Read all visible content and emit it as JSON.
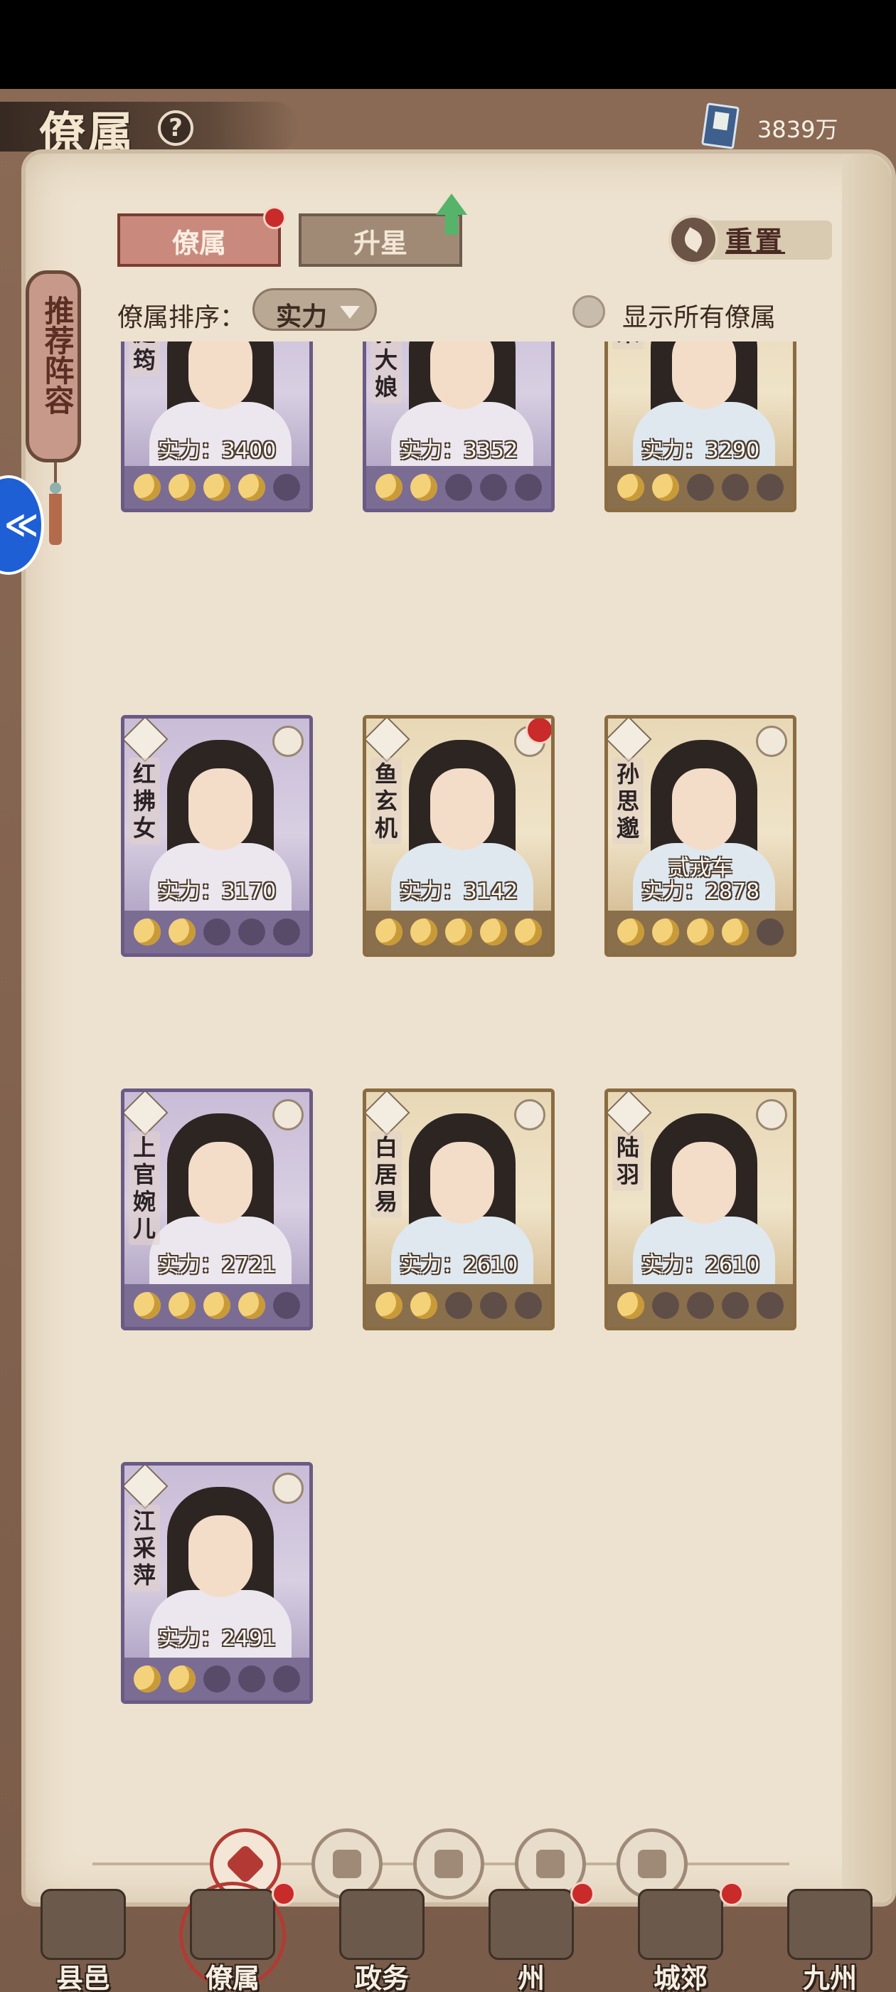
{
  "header": {
    "title": "僚属",
    "help": "?",
    "currency_value": "3839万"
  },
  "side_tag": {
    "label": "推荐阵容"
  },
  "tabs": [
    {
      "label": "僚属",
      "active": true,
      "badge": true
    },
    {
      "label": "升星",
      "active": false,
      "arrow": true
    }
  ],
  "reset_label": "重置",
  "sort": {
    "label": "僚属排序：",
    "value": "实力"
  },
  "show_all_label": "显示所有僚属",
  "cards": [
    {
      "name": "庭筠",
      "power": "实力：3400",
      "theme": "purple",
      "stars": 4,
      "star_total": 5,
      "red_dot": false,
      "subtag": ""
    },
    {
      "name": "公孙大娘",
      "display_name": "孙大娘",
      "power": "实力：3352",
      "theme": "purple",
      "stars": 2,
      "star_total": 5,
      "red_dot": false,
      "subtag": ""
    },
    {
      "name": "张果",
      "display_name": "果",
      "power": "实力：3290",
      "theme": "gold",
      "stars": 2,
      "star_total": 5,
      "red_dot": false,
      "subtag": ""
    },
    {
      "name": "红拂女",
      "power": "实力：3170",
      "theme": "purple",
      "stars": 2,
      "star_total": 5,
      "red_dot": false,
      "subtag": ""
    },
    {
      "name": "鱼玄机",
      "power": "实力：3142",
      "theme": "gold",
      "stars": 5,
      "star_total": 5,
      "red_dot": true,
      "subtag": ""
    },
    {
      "name": "孙思邈",
      "power": "实力：2878",
      "theme": "gold",
      "stars": 4,
      "star_total": 5,
      "red_dot": false,
      "subtag": "贰戎车"
    },
    {
      "name": "上官婉儿",
      "power": "实力：2721",
      "theme": "purple",
      "stars": 4,
      "star_total": 5,
      "red_dot": false,
      "subtag": ""
    },
    {
      "name": "白居易",
      "power": "实力：2610",
      "theme": "gold",
      "stars": 2,
      "star_total": 5,
      "red_dot": false,
      "subtag": ""
    },
    {
      "name": "陆羽",
      "power": "实力：2610",
      "theme": "gold",
      "stars": 1,
      "star_total": 5,
      "red_dot": false,
      "subtag": ""
    },
    {
      "name": "江采萍",
      "power": "实力：2491",
      "theme": "purple",
      "stars": 2,
      "star_total": 5,
      "red_dot": false,
      "subtag": ""
    }
  ],
  "filters": [
    {
      "icon": "all-filter-icon",
      "active": true
    },
    {
      "icon": "bell-filter-icon",
      "active": false
    },
    {
      "icon": "gourd-filter-icon",
      "active": false
    },
    {
      "icon": "fan-filter-icon",
      "active": false
    },
    {
      "icon": "beast-filter-icon",
      "active": false
    }
  ],
  "bottom_nav": [
    {
      "label": "县邑",
      "icon": "town-icon",
      "badge": false,
      "active": false
    },
    {
      "label": "僚属",
      "icon": "subordinates-icon",
      "badge": true,
      "active": true
    },
    {
      "label": "政务",
      "icon": "affairs-icon",
      "badge": false,
      "active": false
    },
    {
      "label": "州",
      "icon": "prefecture-icon",
      "badge": true,
      "active": false
    },
    {
      "label": "城郊",
      "icon": "suburb-icon",
      "badge": true,
      "active": false
    },
    {
      "label": "九州",
      "icon": "nine-provinces-icon",
      "badge": false,
      "active": false
    }
  ]
}
